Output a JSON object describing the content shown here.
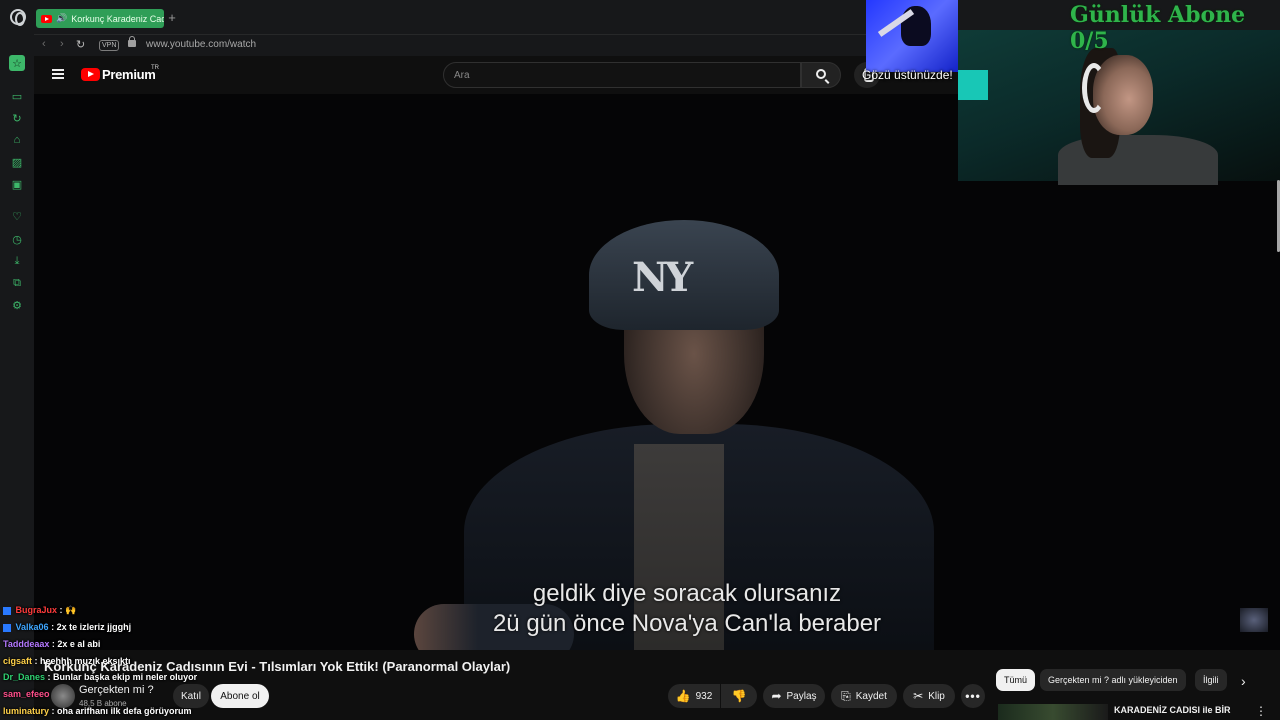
{
  "browser": {
    "tab_title": "Korkunç Karadeniz Cadısının Evi - Tılsımları Yok Ettik! (Paranormal Olaylar)",
    "new_tab": "+",
    "vpn_label": "VPN",
    "url": "www.youtube.com/watch"
  },
  "youtube": {
    "brand": "Premium",
    "region": "TR",
    "search_placeholder": "Ara"
  },
  "video": {
    "cap_text": "NY",
    "subtitle_line1": "geldik diye soracak olursanız",
    "subtitle_line2": "2ü gün önce Nova'ya Can'la beraber"
  },
  "stream_overlay": {
    "small_cam_caption": "Gözü üstünüzde!",
    "goal_text": "Günlük Abone 0/5"
  },
  "chat": [
    {
      "user": "BugraJux",
      "message": "🙌",
      "color": "#ff3b3b",
      "badge": true
    },
    {
      "user": "Valka06",
      "message": "2x te izleriz jjgghj",
      "color": "#3ea6ff",
      "badge": true
    },
    {
      "user": "Tadddeaax",
      "message": "2x e al abi",
      "color": "#b478ff",
      "badge": false
    },
    {
      "user": "cigsaft",
      "message": "heehhh muzık eksıktı",
      "color": "#ffd24a",
      "badge": false
    },
    {
      "user": "Dr_Danes",
      "message": "Bunlar başka ekip mi neler oluyor",
      "color": "#2fd071",
      "badge": false
    },
    {
      "user": "sam_efeeo",
      "message": "",
      "color": "#ff4f8b",
      "badge": false
    },
    {
      "user": "luminatury",
      "message": "oha arifhanı ilk defa görüyorum",
      "color": "#ffd24a",
      "badge": false
    }
  ],
  "details": {
    "title": "Korkunç Karadeniz Cadısının Evi - Tılsımları Yok Ettik! (Paranormal Olaylar)",
    "channel": "Gerçekten mi ?",
    "subscribers": "48,5 B abone",
    "join_label": "Katıl",
    "subscribe_label": "Abone ol",
    "likes": "932",
    "share_label": "Paylaş",
    "save_label": "Kaydet",
    "clip_label": "Klip"
  },
  "recommendations": {
    "chips": [
      "Tümü",
      "Gerçekten mi ? adlı yükleyiciden",
      "İlgili"
    ],
    "first_title": "KARADENİZ CADISI ile BİR"
  }
}
